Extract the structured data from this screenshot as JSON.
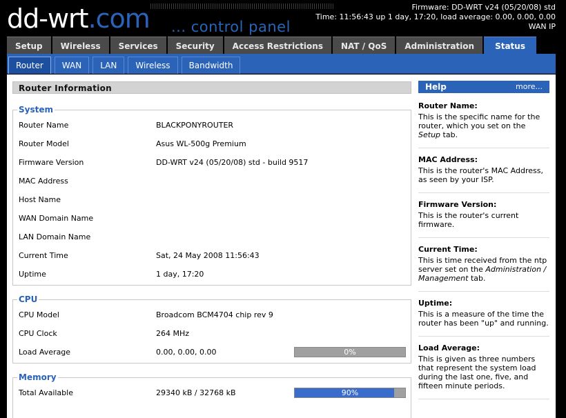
{
  "header": {
    "logo_text": "dd-wrt",
    "logo_domain": ".com",
    "logo_subtitle": "... control panel",
    "firmware": "Firmware: DD-WRT v24 (05/20/08) std",
    "time": "Time: 11:56:43 up 1 day, 17:20, load average: 0.00, 0.00, 0.00",
    "wan_ip": "WAN IP"
  },
  "main_tabs": [
    "Setup",
    "Wireless",
    "Services",
    "Security",
    "Access Restrictions",
    "NAT / QoS",
    "Administration",
    "Status"
  ],
  "active_main_tab": "Status",
  "sub_tabs": [
    "Router",
    "WAN",
    "LAN",
    "Wireless",
    "Bandwidth"
  ],
  "active_sub_tab": "Router",
  "section_title": "Router Information",
  "system": {
    "legend": "System",
    "rows": [
      {
        "label": "Router Name",
        "value": "BLACKPONYROUTER"
      },
      {
        "label": "Router Model",
        "value": "Asus WL-500g Premium"
      },
      {
        "label": "Firmware Version",
        "value": "DD-WRT v24 (05/20/08) std - build 9517"
      },
      {
        "label": "MAC Address",
        "value": ""
      },
      {
        "label": "Host Name",
        "value": ""
      },
      {
        "label": "WAN Domain Name",
        "value": ""
      },
      {
        "label": "LAN Domain Name",
        "value": ""
      },
      {
        "label": "Current Time",
        "value": "Sat, 24 May 2008 11:56:43"
      },
      {
        "label": "Uptime",
        "value": "1 day, 17:20"
      }
    ]
  },
  "cpu": {
    "legend": "CPU",
    "rows": [
      {
        "label": "CPU Model",
        "value": "Broadcom BCM4704 chip rev 9"
      },
      {
        "label": "CPU Clock",
        "value": "264 MHz"
      },
      {
        "label": "Load Average",
        "value": "0.00, 0.00, 0.00"
      }
    ],
    "load_percent": 0,
    "load_label": "0%"
  },
  "memory": {
    "legend": "Memory",
    "rows": [
      {
        "label": "Total Available",
        "value": "29340 kB / 32768 kB"
      }
    ],
    "total_percent": 90,
    "total_label": "90%"
  },
  "help": {
    "title": "Help",
    "more": "more...",
    "items": [
      {
        "title": "Router Name:",
        "text": "This is the specific name for the router, which you set on the ",
        "em": "Setup",
        "tail": " tab."
      },
      {
        "title": "MAC Address:",
        "text": "This is the router's MAC Address, as seen by your ISP.",
        "em": "",
        "tail": ""
      },
      {
        "title": "Firmware Version:",
        "text": "This is the router's current firmware.",
        "em": "",
        "tail": ""
      },
      {
        "title": "Current Time:",
        "text": "This is time received from the ntp server set on the ",
        "em": "Administration / Management",
        "tail": " tab."
      },
      {
        "title": "Uptime:",
        "text": "This is a measure of the time the router has been \"up\" and running.",
        "em": "",
        "tail": ""
      },
      {
        "title": "Load Average:",
        "text": "This is given as three numbers that represent the system load during the last one, five, and fifteen minute periods.",
        "em": "",
        "tail": ""
      }
    ]
  },
  "colors": {
    "accent": "#2a63b8",
    "tab_inactive": "#4a4a4a",
    "header_bg": "#000000",
    "bar_fill": "#3a6ccc"
  }
}
